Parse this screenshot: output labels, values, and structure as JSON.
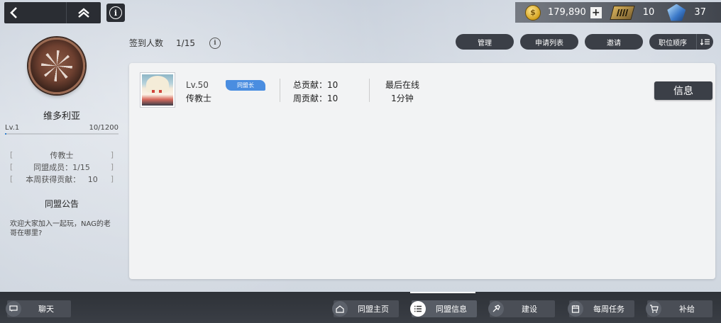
{
  "nav": {
    "back_icon": "chevron-left-icon",
    "home_icon": "double-chevron-up-icon",
    "info_icon": "info-icon"
  },
  "currency": {
    "coins": "179,890",
    "plus": "+",
    "tickets": "10",
    "gems": "37"
  },
  "sidebar": {
    "guild_name": "维多利亚",
    "level": "Lv.1",
    "exp": "10/1200",
    "exp_progress": 0.0083,
    "stats": [
      {
        "label": "传教士"
      },
      {
        "label": "同盟成员：1/15"
      },
      {
        "label": "本周获得贡献：   10"
      }
    ],
    "notice_title": "同盟公告",
    "notice_body": "欢迎大家加入一起玩，NAG的老哥在哪里?"
  },
  "header": {
    "checkin_label": "签到人数",
    "checkin_count": "1/15",
    "buttons": [
      "管理",
      "申请列表",
      "邀请"
    ],
    "sort_label": "职位顺序"
  },
  "members": [
    {
      "level": "Lv.50",
      "role_badge": "同盟长",
      "title": "传教士",
      "total_contrib": "总贡献：10",
      "weekly_contrib": "周贡献：10",
      "online_label": "最后在线",
      "online_value": "1分钟",
      "info_button": "信息"
    }
  ],
  "bottom_nav": {
    "chat": "聊天",
    "tabs": [
      "同盟主页",
      "同盟信息",
      "建设",
      "每周任务",
      "补给"
    ],
    "active_tab": "同盟信息"
  }
}
